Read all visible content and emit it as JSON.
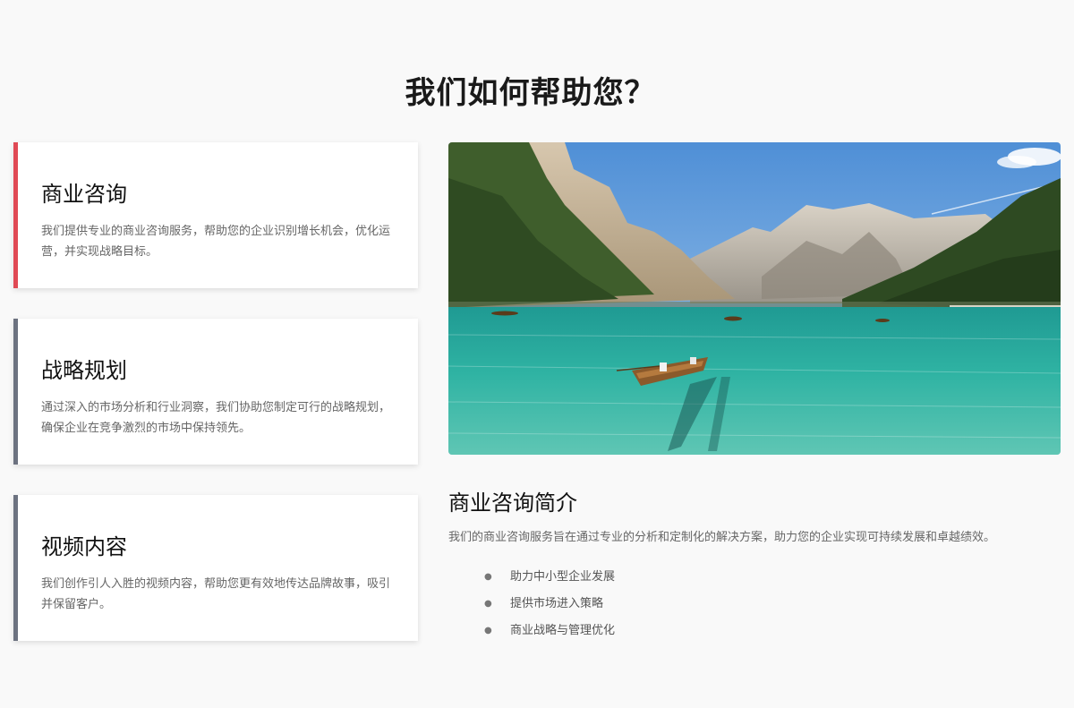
{
  "page": {
    "title": "我们如何帮助您？"
  },
  "services": [
    {
      "title": "商业咨询",
      "description": "我们提供专业的商业咨询服务，帮助您的企业识别增长机会，优化运营，并实现战略目标。",
      "active": true
    },
    {
      "title": "战略规划",
      "description": "通过深入的市场分析和行业洞察，我们协助您制定可行的战略规划，确保企业在竞争激烈的市场中保持领先。",
      "active": false
    },
    {
      "title": "视频内容",
      "description": "我们创作引人入胜的视频内容，帮助您更有效地传达品牌故事，吸引并保留客户。",
      "active": false
    }
  ],
  "intro": {
    "title": "商业咨询简介",
    "description": "我们的商业咨询服务旨在通过专业的分析和定制化的解决方案，助力您的企业实现可持续发展和卓越绩效。",
    "items": [
      "助力中小型企业发展",
      "提供市场进入策略",
      "商业战略与管理优化"
    ]
  },
  "colors": {
    "background": "#f9f9f9",
    "active_accent": "#e04a55",
    "inactive_accent": "#6c7280"
  }
}
